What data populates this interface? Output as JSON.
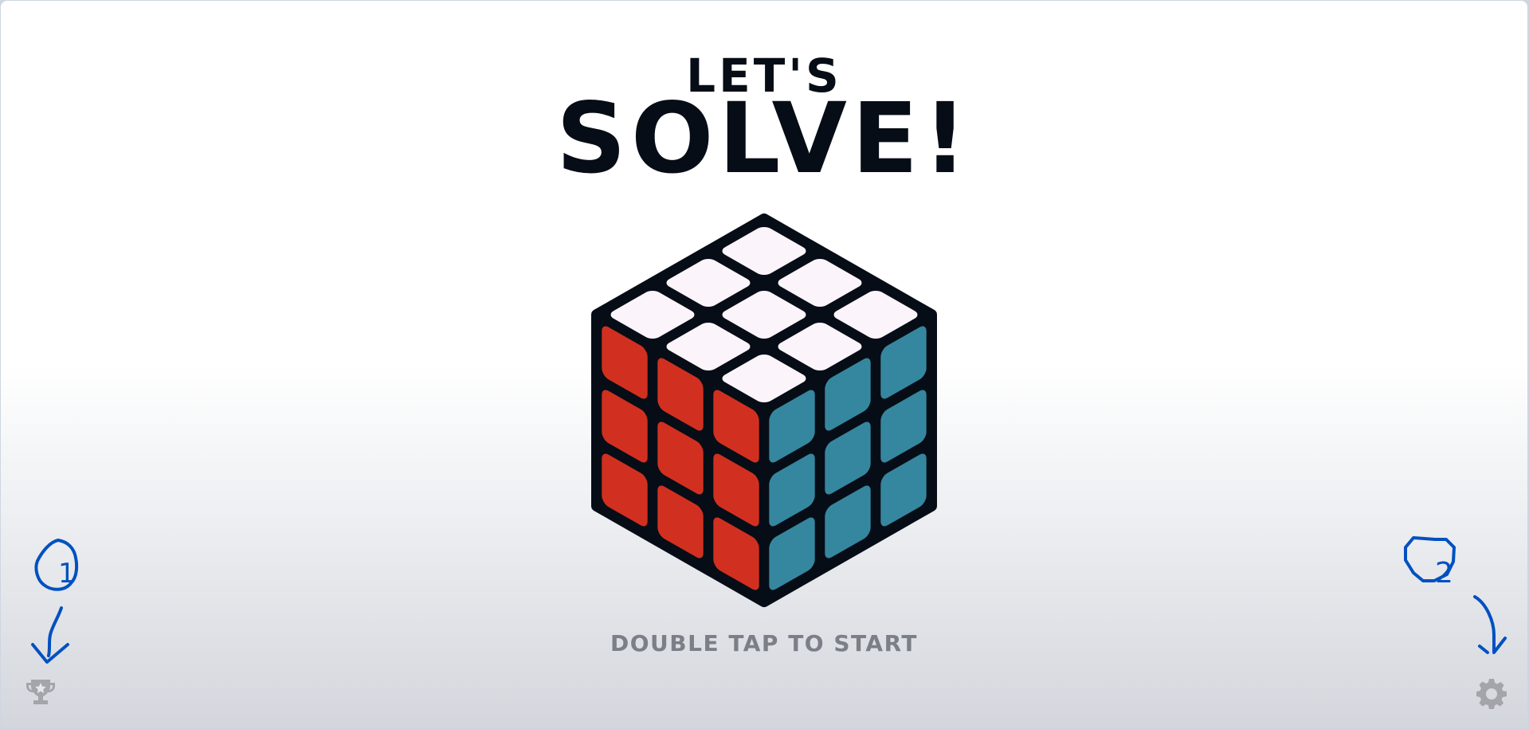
{
  "title": {
    "line1": "LET'S",
    "line2": "SOLVE!"
  },
  "hint": "DOUBLE TAP TO START",
  "cube": {
    "colors": {
      "top": "#fbf5fb",
      "left": "#d13020",
      "right": "#35879f",
      "body": "#070d16"
    }
  },
  "buttons": {
    "leaderboard": {
      "icon": "trophy-icon"
    },
    "settings": {
      "icon": "gear-icon"
    }
  },
  "annotations": [
    {
      "label": "1",
      "color": "#0050c0"
    },
    {
      "label": "2",
      "color": "#0050c0"
    }
  ]
}
